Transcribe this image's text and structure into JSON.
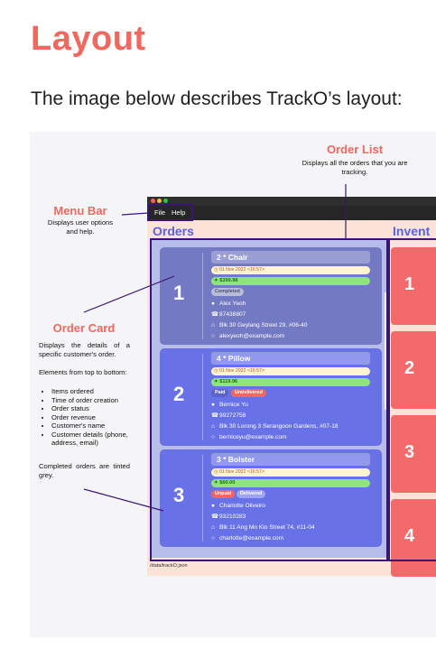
{
  "doc": {
    "title": "Layout",
    "intro": "The image below describes TrackO’s layout:"
  },
  "annotations": {
    "order_list": {
      "title": "Order List",
      "desc": "Displays all the orders that you are tracking."
    },
    "menu_bar": {
      "title": "Menu Bar",
      "desc": "Displays user options and help."
    },
    "order_card": {
      "title": "Order Card",
      "desc": "Displays the details of a specific customer's order.",
      "elements_intro": "Elements from top to bottom:",
      "elements": [
        "Items ordered",
        "Time of order creation",
        "Order status",
        "Order revenue",
        "Customer's name",
        "Customer details (phone, address, email)"
      ],
      "completed_note": "Completed orders are tinted grey."
    }
  },
  "app": {
    "menu": [
      "File",
      "Help"
    ],
    "orders_title": "Orders",
    "inventory_title": "Invent",
    "status_path": "/data/trackO.json",
    "orders": [
      {
        "index": "1",
        "item": "2 * Chair",
        "time": "01 Nov 2022 <16:57>",
        "price": "$399.98",
        "statuses": [
          "Completed"
        ],
        "name": "Alex Yeoh",
        "phone": "87438807",
        "address": "Blk 30 Geylang Street 29, #06-40",
        "email": "alexyeoh@example.com",
        "color": "#7379c2"
      },
      {
        "index": "2",
        "item": "4 * Pillow",
        "time": "01 Nov 2022 <16:57>",
        "price": "$119.96",
        "statuses": [
          "Paid",
          "Undelivered"
        ],
        "name": "Bernice Yu",
        "phone": "99272758",
        "address": "Blk 30 Lorong 3 Serangoon Gardens, #07-18",
        "email": "berniceyu@example.com",
        "color": "#6872e6"
      },
      {
        "index": "3",
        "item": "3 * Bolster",
        "time": "01 Nov 2022 <16:57>",
        "price": "$60.00",
        "statuses": [
          "Unpaid",
          "Delivered"
        ],
        "name": "Charlotte Oliveiro",
        "phone": "93210283",
        "address": "Blk 11 Ang Mo Kio Street 74, #11-04",
        "email": "charlotte@example.com",
        "color": "#6872e6"
      }
    ],
    "inventory_indices": [
      "1",
      "2",
      "3",
      "4"
    ]
  },
  "colors": {
    "accent": "#f0685f",
    "highlight": "#3a1577",
    "completed_badge": "#b9bcd6",
    "paid_badge": "#6b72d8",
    "undelivered_badge": "#f0685f",
    "unpaid_badge": "#f0685f",
    "delivered_badge": "#9fa5f0"
  },
  "icons": {
    "name": "person-icon",
    "phone": "phone-icon",
    "address": "home-icon",
    "email": "email-icon",
    "time": "clock-icon",
    "price": "tag-icon"
  }
}
